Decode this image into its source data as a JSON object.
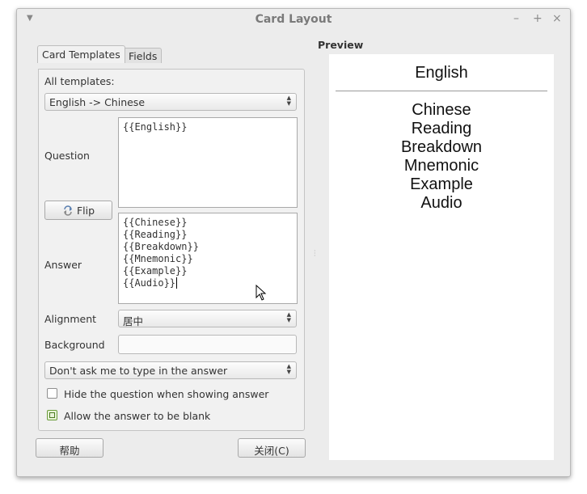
{
  "window": {
    "title": "Card Layout"
  },
  "tabs": [
    {
      "label": "Card Templates"
    },
    {
      "label": "Fields"
    }
  ],
  "templates": {
    "label": "All templates:",
    "selected": "English -> Chinese"
  },
  "question": {
    "label": "Question",
    "lines": [
      "{{English}}"
    ]
  },
  "flip": {
    "label": "Flip"
  },
  "answer": {
    "label": "Answer",
    "lines": [
      "{{Chinese}}",
      "{{Reading}}",
      "{{Breakdown}}",
      "{{Mnemonic}}",
      "{{Example}}",
      "{{Audio}}"
    ]
  },
  "alignment": {
    "label": "Alignment",
    "selected": "居中"
  },
  "background": {
    "label": "Background",
    "value": ""
  },
  "type_answer": {
    "selected": "Don't ask me to type in the answer"
  },
  "checkboxes": [
    {
      "label": "Hide the question when showing answer",
      "checked": false
    },
    {
      "label": "Allow the answer to be blank",
      "checked": true
    }
  ],
  "buttons": {
    "help": "帮助",
    "close": "关闭(C)"
  },
  "preview": {
    "heading": "Preview",
    "question": "English",
    "answer_lines": [
      "Chinese",
      "Reading",
      "Breakdown",
      "Mnemonic",
      "Example",
      "Audio"
    ]
  },
  "icons": {
    "menu": "chevron-down-icon",
    "minimize": "minimize-icon",
    "maximize": "maximize-icon",
    "close": "close-icon",
    "flip": "flip-icon"
  }
}
